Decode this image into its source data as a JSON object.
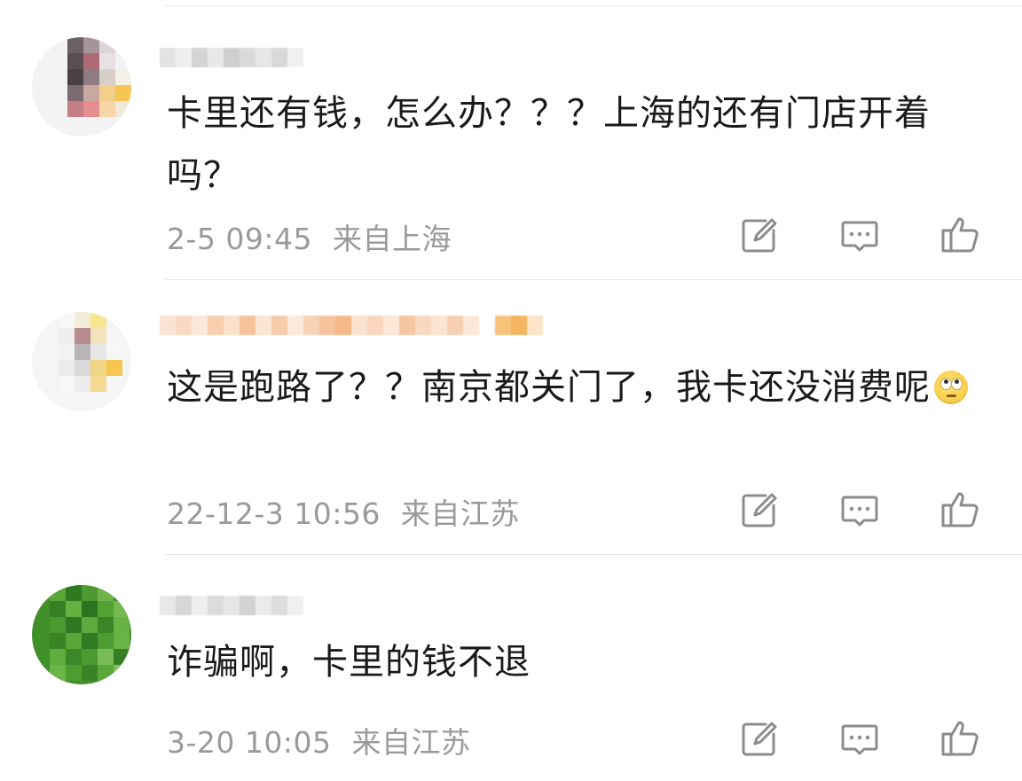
{
  "comments": [
    {
      "text": "卡里还有钱，怎么办？？？上海的还有门店开着吗？",
      "time": "2-5 09:45",
      "location": "来自上海"
    },
    {
      "text": "这是跑路了？？南京都关门了，我卡还没消费呢",
      "emoji": "eye-roll-emoji",
      "time": "22-12-3 10:56",
      "location": "来自江苏"
    },
    {
      "text": "诈骗啊，卡里的钱不退",
      "time": "3-20 10:05",
      "location": "来自江苏"
    }
  ],
  "icons": {
    "share": "share-edit-icon",
    "reply": "comment-reply-icon",
    "like": "thumbs-up-icon"
  },
  "colors": {
    "text": "#1a1a1a",
    "meta": "#9a9a9a",
    "icon": "#8c8c8c",
    "divider": "#e6e6e6"
  }
}
